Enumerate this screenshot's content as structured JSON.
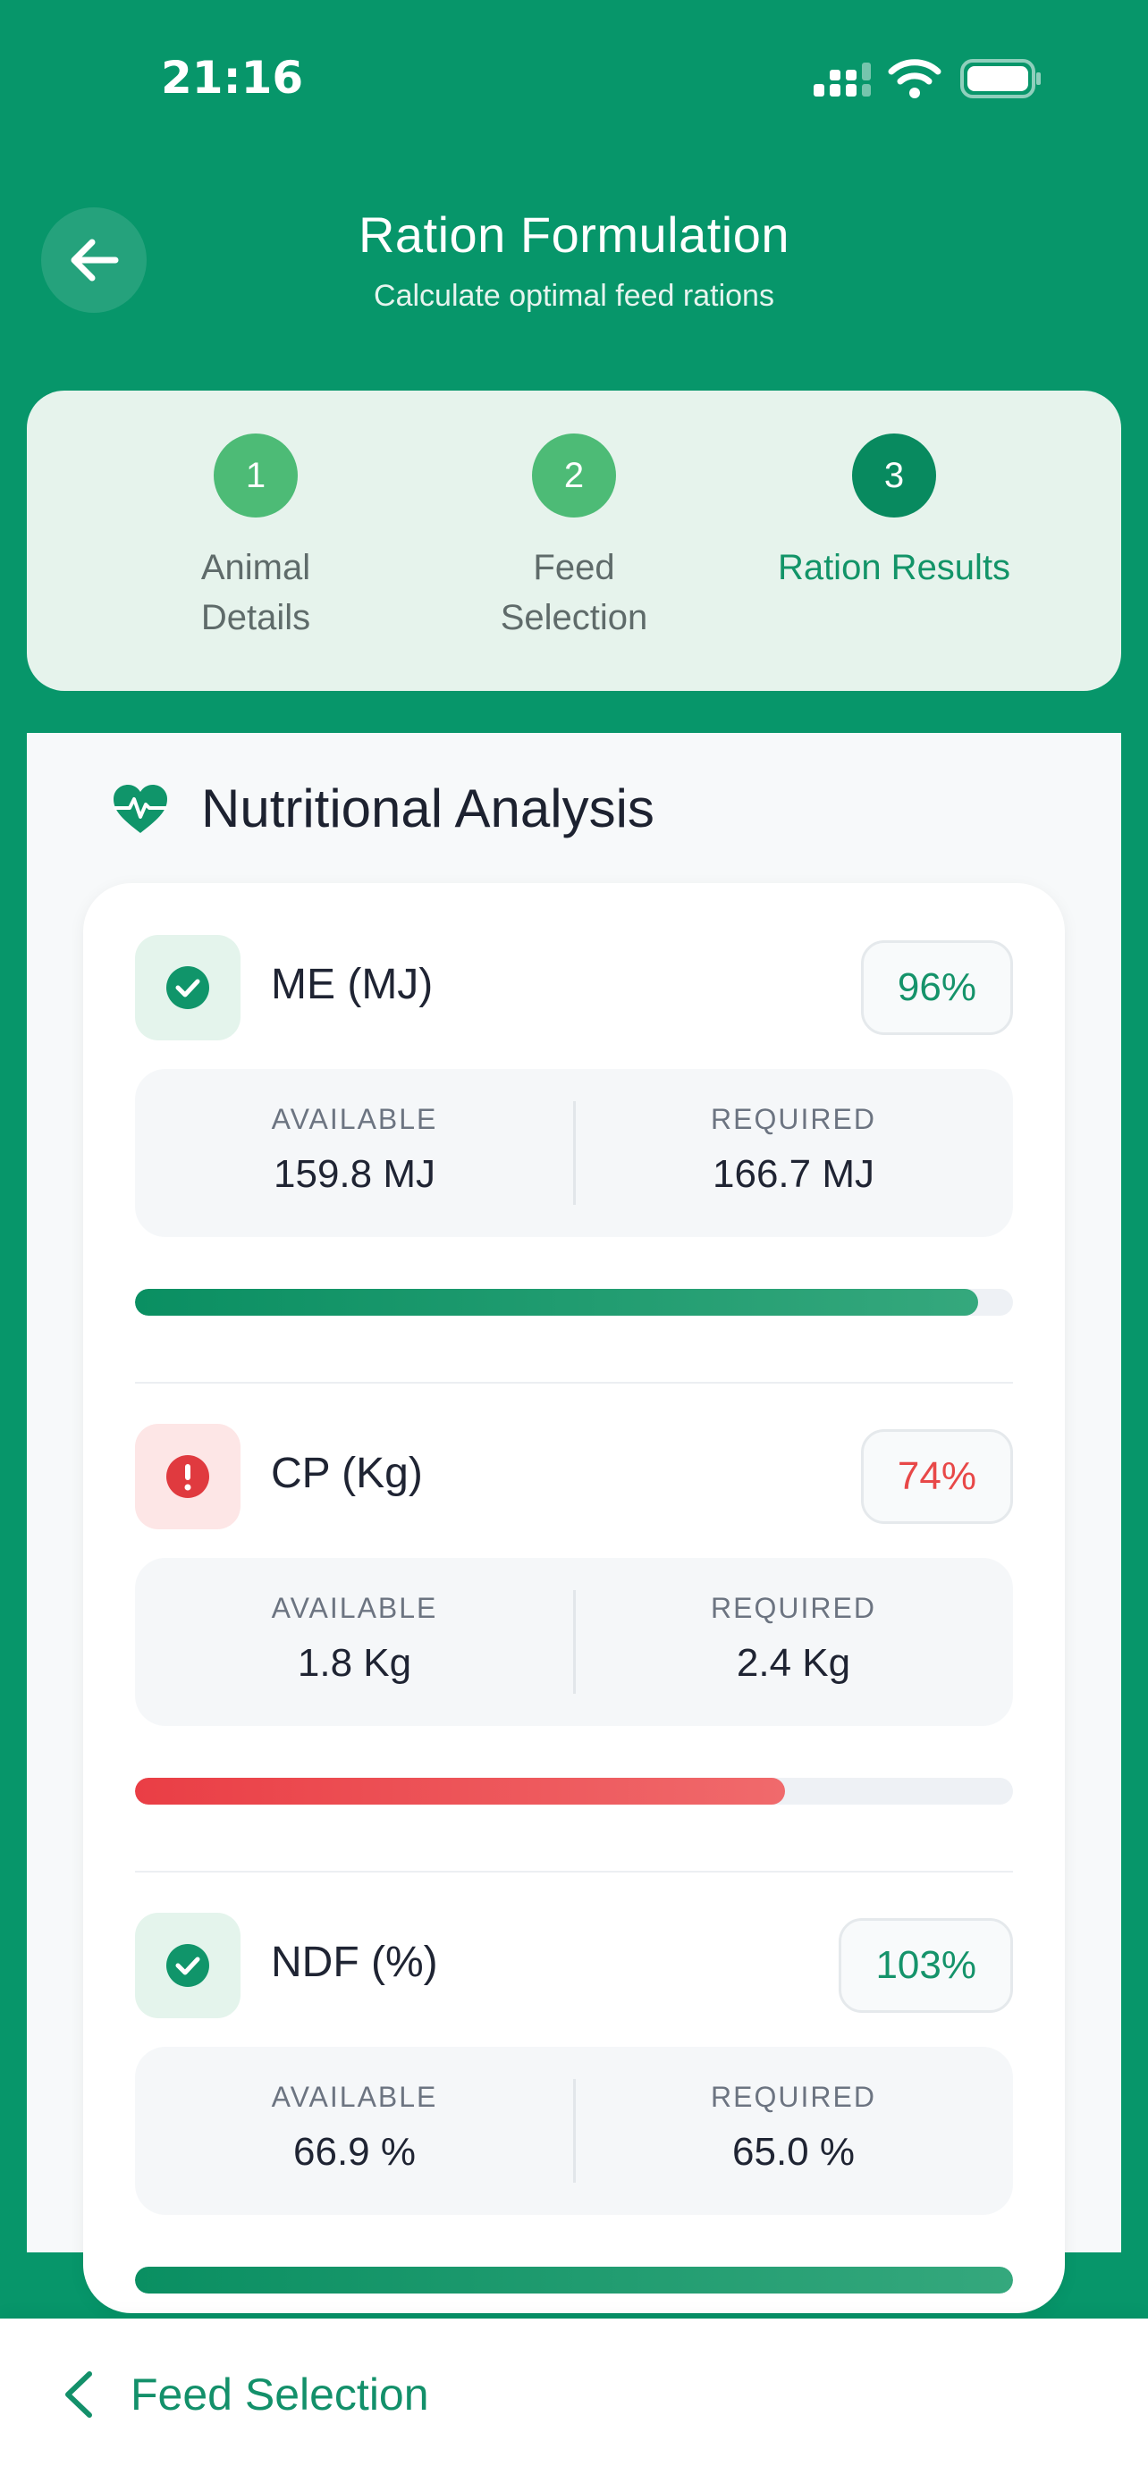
{
  "status_bar": {
    "time": "21:16"
  },
  "header": {
    "title": "Ration Formulation",
    "subtitle": "Calculate optimal feed rations"
  },
  "stepper": {
    "steps": [
      {
        "number": "1",
        "label": "Animal\nDetails",
        "state": "done"
      },
      {
        "number": "2",
        "label": "Feed\nSelection",
        "state": "done"
      },
      {
        "number": "3",
        "label": "Ration Results",
        "state": "active"
      }
    ]
  },
  "analysis": {
    "title": "Nutritional Analysis",
    "available_label": "AVAILABLE",
    "required_label": "REQUIRED",
    "nutrients": [
      {
        "name": "ME (MJ)",
        "percent": "96%",
        "available": "159.8 MJ",
        "required": "166.7 MJ",
        "status": "ok",
        "progress": 0.96
      },
      {
        "name": "CP (Kg)",
        "percent": "74%",
        "available": "1.8 Kg",
        "required": "2.4 Kg",
        "status": "bad",
        "progress": 0.74
      },
      {
        "name": "NDF (%)",
        "percent": "103%",
        "available": "66.9 %",
        "required": "65.0 %",
        "status": "ok",
        "progress": 1.0
      }
    ]
  },
  "bottom_nav": {
    "back_label": "Feed Selection"
  },
  "colors": {
    "primary": "#07966a",
    "success": "#15936a",
    "danger": "#e84848"
  }
}
